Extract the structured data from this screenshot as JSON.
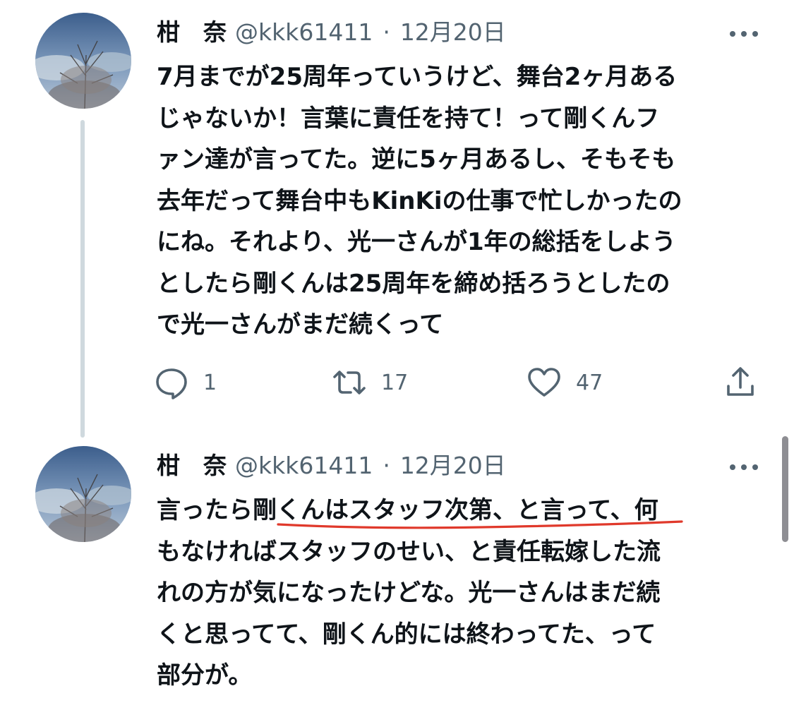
{
  "tweets": [
    {
      "name": "柑　奈",
      "handle": "@kkk61411",
      "separator": "·",
      "date": "12月20日",
      "lines": [
        "7月までが25周年っていうけど、舞台2ヶ月ある",
        "じゃないか！言葉に責任を持て！って剛くんフ",
        "ァン達が言ってた。逆に5ヶ月あるし、そもそも",
        "去年だって舞台中もKinKiの仕事で忙しかったの",
        "にね。それより、光一さんが1年の総括をしよう",
        "としたら剛くんは25周年を締め括ろうとしたの",
        "で光一さんがまだ続くって"
      ],
      "replies": "1",
      "retweets": "17",
      "likes": "47"
    },
    {
      "name": "柑　奈",
      "handle": "@kkk61411",
      "separator": "·",
      "date": "12月20日",
      "lines": [
        "言ったら剛くんはスタッフ次第、と言って、何",
        "もなければスタッフのせい、と責任転嫁した流",
        "れの方が気になったけどな。光一さんはまだ続",
        "くと思ってて、剛くん的には終わってた、って",
        "部分が。"
      ]
    }
  ],
  "icons": {
    "more": "more-horizontal-icon",
    "reply": "reply-icon",
    "retweet": "retweet-icon",
    "like": "heart-icon",
    "share": "share-icon"
  },
  "colors": {
    "text": "#0f1419",
    "secondary": "#536471",
    "thread_line": "#cfd9de",
    "annotation": "#e0392b"
  }
}
